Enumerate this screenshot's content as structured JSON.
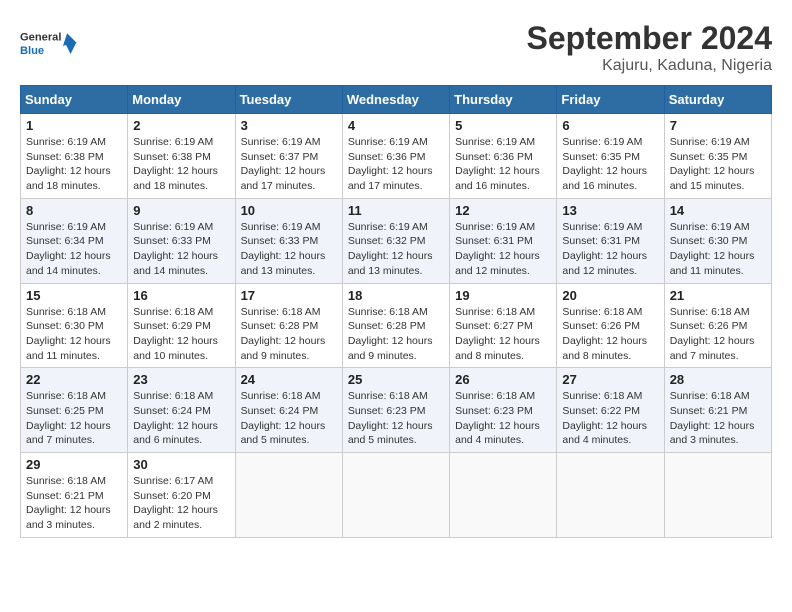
{
  "header": {
    "logo_general": "General",
    "logo_blue": "Blue",
    "title": "September 2024",
    "subtitle": "Kajuru, Kaduna, Nigeria"
  },
  "days_of_week": [
    "Sunday",
    "Monday",
    "Tuesday",
    "Wednesday",
    "Thursday",
    "Friday",
    "Saturday"
  ],
  "weeks": [
    [
      {
        "day": "1",
        "sunrise": "6:19 AM",
        "sunset": "6:38 PM",
        "daylight": "12 hours and 18 minutes."
      },
      {
        "day": "2",
        "sunrise": "6:19 AM",
        "sunset": "6:38 PM",
        "daylight": "12 hours and 18 minutes."
      },
      {
        "day": "3",
        "sunrise": "6:19 AM",
        "sunset": "6:37 PM",
        "daylight": "12 hours and 17 minutes."
      },
      {
        "day": "4",
        "sunrise": "6:19 AM",
        "sunset": "6:36 PM",
        "daylight": "12 hours and 17 minutes."
      },
      {
        "day": "5",
        "sunrise": "6:19 AM",
        "sunset": "6:36 PM",
        "daylight": "12 hours and 16 minutes."
      },
      {
        "day": "6",
        "sunrise": "6:19 AM",
        "sunset": "6:35 PM",
        "daylight": "12 hours and 16 minutes."
      },
      {
        "day": "7",
        "sunrise": "6:19 AM",
        "sunset": "6:35 PM",
        "daylight": "12 hours and 15 minutes."
      }
    ],
    [
      {
        "day": "8",
        "sunrise": "6:19 AM",
        "sunset": "6:34 PM",
        "daylight": "12 hours and 14 minutes."
      },
      {
        "day": "9",
        "sunrise": "6:19 AM",
        "sunset": "6:33 PM",
        "daylight": "12 hours and 14 minutes."
      },
      {
        "day": "10",
        "sunrise": "6:19 AM",
        "sunset": "6:33 PM",
        "daylight": "12 hours and 13 minutes."
      },
      {
        "day": "11",
        "sunrise": "6:19 AM",
        "sunset": "6:32 PM",
        "daylight": "12 hours and 13 minutes."
      },
      {
        "day": "12",
        "sunrise": "6:19 AM",
        "sunset": "6:31 PM",
        "daylight": "12 hours and 12 minutes."
      },
      {
        "day": "13",
        "sunrise": "6:19 AM",
        "sunset": "6:31 PM",
        "daylight": "12 hours and 12 minutes."
      },
      {
        "day": "14",
        "sunrise": "6:19 AM",
        "sunset": "6:30 PM",
        "daylight": "12 hours and 11 minutes."
      }
    ],
    [
      {
        "day": "15",
        "sunrise": "6:18 AM",
        "sunset": "6:30 PM",
        "daylight": "12 hours and 11 minutes."
      },
      {
        "day": "16",
        "sunrise": "6:18 AM",
        "sunset": "6:29 PM",
        "daylight": "12 hours and 10 minutes."
      },
      {
        "day": "17",
        "sunrise": "6:18 AM",
        "sunset": "6:28 PM",
        "daylight": "12 hours and 9 minutes."
      },
      {
        "day": "18",
        "sunrise": "6:18 AM",
        "sunset": "6:28 PM",
        "daylight": "12 hours and 9 minutes."
      },
      {
        "day": "19",
        "sunrise": "6:18 AM",
        "sunset": "6:27 PM",
        "daylight": "12 hours and 8 minutes."
      },
      {
        "day": "20",
        "sunrise": "6:18 AM",
        "sunset": "6:26 PM",
        "daylight": "12 hours and 8 minutes."
      },
      {
        "day": "21",
        "sunrise": "6:18 AM",
        "sunset": "6:26 PM",
        "daylight": "12 hours and 7 minutes."
      }
    ],
    [
      {
        "day": "22",
        "sunrise": "6:18 AM",
        "sunset": "6:25 PM",
        "daylight": "12 hours and 7 minutes."
      },
      {
        "day": "23",
        "sunrise": "6:18 AM",
        "sunset": "6:24 PM",
        "daylight": "12 hours and 6 minutes."
      },
      {
        "day": "24",
        "sunrise": "6:18 AM",
        "sunset": "6:24 PM",
        "daylight": "12 hours and 5 minutes."
      },
      {
        "day": "25",
        "sunrise": "6:18 AM",
        "sunset": "6:23 PM",
        "daylight": "12 hours and 5 minutes."
      },
      {
        "day": "26",
        "sunrise": "6:18 AM",
        "sunset": "6:23 PM",
        "daylight": "12 hours and 4 minutes."
      },
      {
        "day": "27",
        "sunrise": "6:18 AM",
        "sunset": "6:22 PM",
        "daylight": "12 hours and 4 minutes."
      },
      {
        "day": "28",
        "sunrise": "6:18 AM",
        "sunset": "6:21 PM",
        "daylight": "12 hours and 3 minutes."
      }
    ],
    [
      {
        "day": "29",
        "sunrise": "6:18 AM",
        "sunset": "6:21 PM",
        "daylight": "12 hours and 3 minutes."
      },
      {
        "day": "30",
        "sunrise": "6:17 AM",
        "sunset": "6:20 PM",
        "daylight": "12 hours and 2 minutes."
      },
      null,
      null,
      null,
      null,
      null
    ]
  ]
}
